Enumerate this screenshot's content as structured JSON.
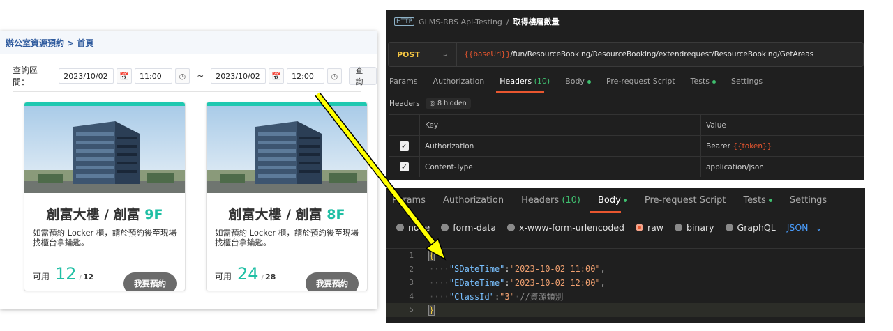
{
  "booking": {
    "breadcrumb": "辦公室資源預約 > 首頁",
    "query_label": "查詢區間：",
    "start_date": "2023/10/02",
    "start_time": "11:00",
    "tilde": "~",
    "end_date": "2023/10/02",
    "end_time": "12:00",
    "query_button": "查詢",
    "cards": [
      {
        "title": "創富大樓 / 創富 ",
        "floor": "9F",
        "desc": "如需預約 Locker 櫃，請於預約後至現場找櫃台拿鑰匙。",
        "avail_label": "可用",
        "avail": "12",
        "total": "12",
        "book": "我要預約"
      },
      {
        "title": "創富大樓 / 創富 ",
        "floor": "8F",
        "desc": "如需預約 Locker 櫃，請於預約後至現場找櫃台拿鑰匙。",
        "avail_label": "可用",
        "avail": "24",
        "total": "28",
        "book": "我要預約"
      }
    ]
  },
  "postman_top": {
    "badge": "HTTP",
    "collection": "GLMS-RBS Api-Testing",
    "separator": "/",
    "request_name": "取得樓層數量",
    "method": "POST",
    "url_var": "{{baseUri}}",
    "url_path": "/fun/ResourceBooking/ResourceBooking/extendrequest/ResourceBooking/GetAreas",
    "tabs": {
      "params": "Params",
      "authorization": "Authorization",
      "headers": "Headers",
      "headers_count": "(10)",
      "body": "Body",
      "prerequest": "Pre-request Script",
      "tests": "Tests",
      "settings": "Settings"
    },
    "headers_label": "Headers",
    "hidden_label": "8 hidden",
    "table": {
      "key_header": "Key",
      "value_header": "Value",
      "rows": [
        {
          "key": "Authorization",
          "value_prefix": "Bearer ",
          "value_var": "{{token}}"
        },
        {
          "key": "Content-Type",
          "value_prefix": "application/json",
          "value_var": ""
        }
      ]
    }
  },
  "postman_bottom": {
    "tabs": {
      "params": "Params",
      "authorization": "Authorization",
      "headers": "Headers",
      "headers_count": "(10)",
      "body": "Body",
      "prerequest": "Pre-request Script",
      "tests": "Tests",
      "settings": "Settings"
    },
    "body_types": [
      "none",
      "form-data",
      "x-www-form-urlencoded",
      "raw",
      "binary",
      "GraphQL"
    ],
    "selected_body_type": "raw",
    "format": "JSON",
    "code_lines": [
      {
        "n": "1",
        "text": "{"
      },
      {
        "n": "2",
        "key": "\"SDateTime\"",
        "value": "\"2023-10-02 11:00\"",
        "tail": ","
      },
      {
        "n": "3",
        "key": "\"EDateTime\"",
        "value": "\"2023-10-02 12:00\"",
        "tail": ","
      },
      {
        "n": "4",
        "key": "\"ClassId\"",
        "value": "\"3\"",
        "comment": "//資源類別"
      },
      {
        "n": "5",
        "text": "}"
      }
    ]
  },
  "colors": {
    "accent_teal": "#1fbfa4",
    "postman_orange": "#e8562f",
    "arrow_yellow": "#ffff00"
  }
}
